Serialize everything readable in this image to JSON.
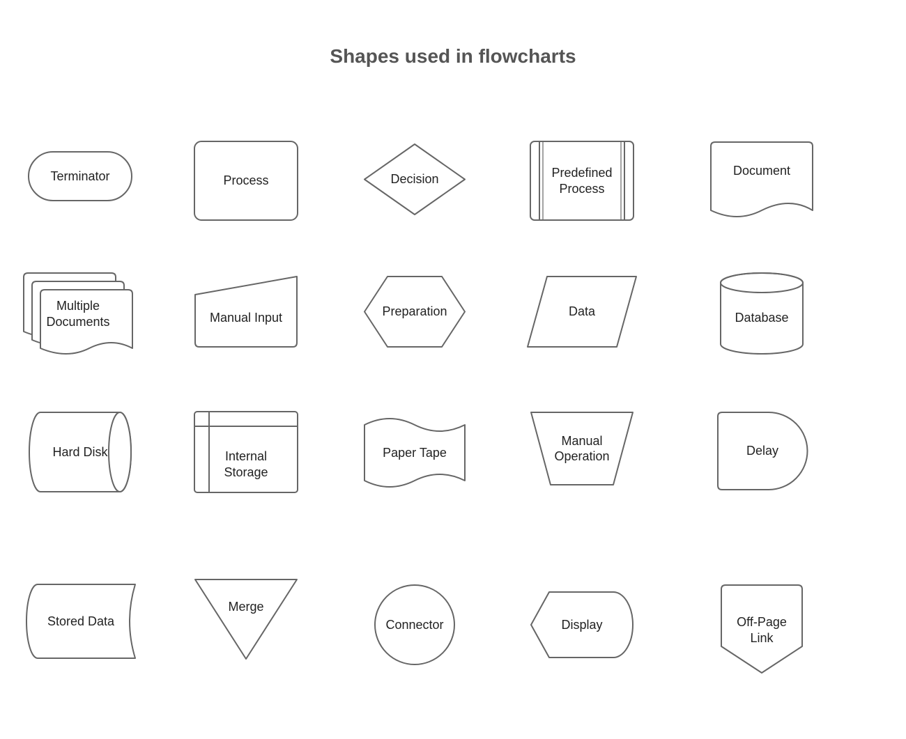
{
  "title": "Shapes used in flowcharts",
  "shapes": {
    "terminator": "Terminator",
    "process": "Process",
    "decision": "Decision",
    "predefined_process": "Predefined\nProcess",
    "document": "Document",
    "multiple_documents": "Multiple\nDocuments",
    "manual_input": "Manual Input",
    "preparation": "Preparation",
    "data": "Data",
    "database": "Database",
    "hard_disk": "Hard Disk",
    "internal_storage": "Internal\nStorage",
    "paper_tape": "Paper Tape",
    "manual_operation": "Manual\nOperation",
    "delay": "Delay",
    "stored_data": "Stored Data",
    "merge": "Merge",
    "connector": "Connector",
    "display": "Display",
    "off_page_link": "Off-Page\nLink"
  },
  "colors": {
    "stroke": "#666",
    "fill": "#ffffff"
  }
}
